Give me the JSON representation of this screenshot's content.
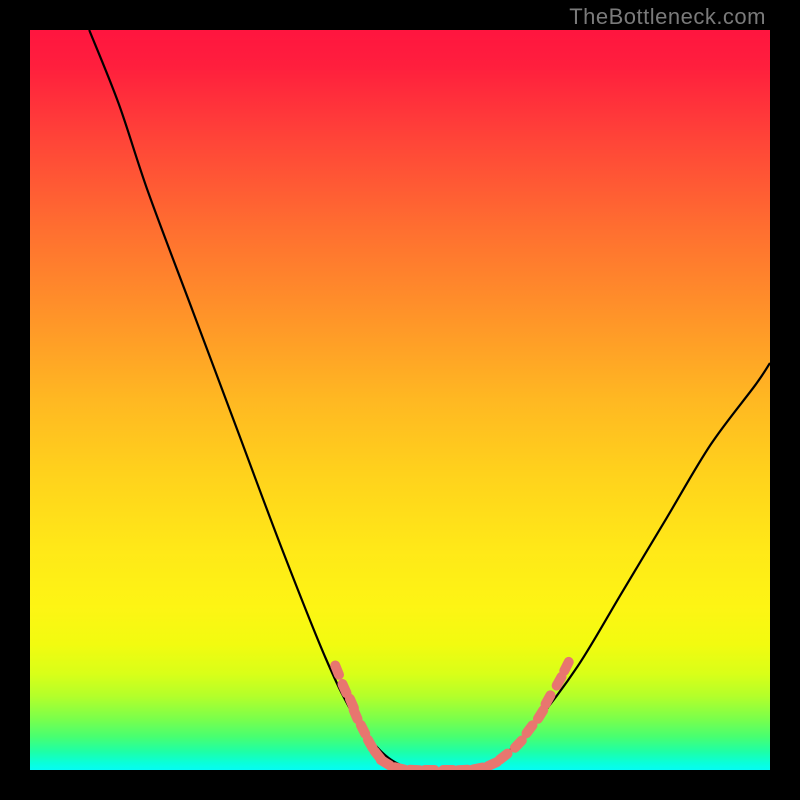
{
  "watermark": "TheBottleneck.com",
  "colors": {
    "background": "#000000",
    "gradient_top": "#ff153f",
    "gradient_bottom": "#06fcf4",
    "curve": "#000000",
    "markers": "#e8766f"
  },
  "chart_data": {
    "type": "line",
    "title": "",
    "xlabel": "",
    "ylabel": "",
    "xlim": [
      0,
      100
    ],
    "ylim": [
      0,
      100
    ],
    "grid": false,
    "legend": false,
    "curve_points": [
      {
        "x": 8,
        "y": 100
      },
      {
        "x": 12,
        "y": 90
      },
      {
        "x": 16,
        "y": 78
      },
      {
        "x": 22,
        "y": 62
      },
      {
        "x": 28,
        "y": 46
      },
      {
        "x": 34,
        "y": 30
      },
      {
        "x": 40,
        "y": 15
      },
      {
        "x": 44,
        "y": 7
      },
      {
        "x": 48,
        "y": 2
      },
      {
        "x": 52,
        "y": 0
      },
      {
        "x": 56,
        "y": 0
      },
      {
        "x": 60,
        "y": 0
      },
      {
        "x": 64,
        "y": 2
      },
      {
        "x": 68,
        "y": 6
      },
      {
        "x": 74,
        "y": 14
      },
      {
        "x": 80,
        "y": 24
      },
      {
        "x": 86,
        "y": 34
      },
      {
        "x": 92,
        "y": 44
      },
      {
        "x": 98,
        "y": 52
      },
      {
        "x": 100,
        "y": 55
      }
    ],
    "marker_points": [
      {
        "x": 41.5,
        "y": 13.5
      },
      {
        "x": 42.5,
        "y": 11.0
      },
      {
        "x": 43.5,
        "y": 9.0
      },
      {
        "x": 44.0,
        "y": 7.5
      },
      {
        "x": 45.0,
        "y": 5.5
      },
      {
        "x": 46.0,
        "y": 3.5
      },
      {
        "x": 47.0,
        "y": 2.0
      },
      {
        "x": 48.0,
        "y": 1.0
      },
      {
        "x": 50.0,
        "y": 0.2
      },
      {
        "x": 52.0,
        "y": 0.0
      },
      {
        "x": 54.0,
        "y": 0.0
      },
      {
        "x": 56.5,
        "y": 0.0
      },
      {
        "x": 58.5,
        "y": 0.0
      },
      {
        "x": 60.5,
        "y": 0.2
      },
      {
        "x": 62.5,
        "y": 0.8
      },
      {
        "x": 64.0,
        "y": 1.8
      },
      {
        "x": 66.0,
        "y": 3.5
      },
      {
        "x": 67.5,
        "y": 5.5
      },
      {
        "x": 69.0,
        "y": 7.5
      },
      {
        "x": 70.0,
        "y": 9.5
      },
      {
        "x": 71.5,
        "y": 12.0
      },
      {
        "x": 72.5,
        "y": 14.0
      }
    ]
  }
}
